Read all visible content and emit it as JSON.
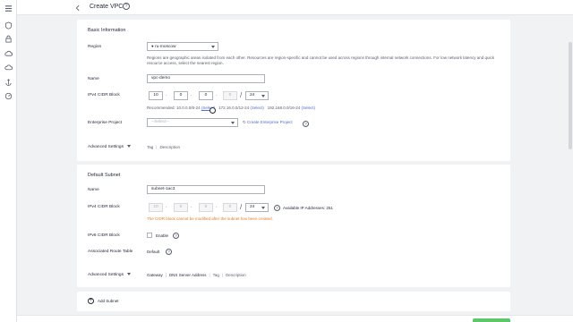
{
  "header": {
    "title": "Create VPC",
    "help_glyph": "?"
  },
  "rail": {
    "items": [
      "menu-icon",
      "shield-icon",
      "lock-icon",
      "cloud-icon",
      "cloud-outline-icon",
      "anchor-icon",
      "gauge-icon"
    ]
  },
  "basic": {
    "section_title": "Basic Information",
    "region": {
      "label": "Region",
      "value": "ru-moscow",
      "hint": "Regions are geographic areas isolated from each other. Resources are region-specific and cannot be used across regions through internal network connections. For low network latency and quick resource access, select the nearest region."
    },
    "name": {
      "label": "Name",
      "value": "vpc-demo"
    },
    "cidr": {
      "label": "IPv4 CIDR Block",
      "octets": [
        "10",
        "0",
        "0",
        "0"
      ],
      "mask": "24",
      "recommended_label": "Recommended:",
      "options": [
        {
          "cidr": "10.0.0.0/8-24",
          "action": "(Select)"
        },
        {
          "cidr": "172.16.0.0/12-24",
          "action": "(Select)"
        },
        {
          "cidr": "192.168.0.0/16-24",
          "action": "(Select)"
        }
      ]
    },
    "enterprise": {
      "label": "Enterprise Project",
      "placeholder": "--Select--",
      "create_link": "Create Enterprise Project"
    },
    "advanced": {
      "label": "Advanced Settings",
      "tabs": [
        "Tag",
        "Description"
      ]
    }
  },
  "subnet": {
    "section_title": "Default Subnet",
    "name": {
      "label": "Name",
      "value": "subnet-1ac3"
    },
    "cidr": {
      "label": "IPv4 CIDR Block",
      "octets": [
        "10",
        "0",
        "0",
        "0"
      ],
      "mask": "24",
      "available": "Available IP Addresses: 251",
      "warning": "The CIDR block cannot be modified after the subnet has been created."
    },
    "ipv6": {
      "label": "IPv6 CIDR Block",
      "checkbox_label": "Enable"
    },
    "route": {
      "label": "Associated Route Table",
      "value": "Default"
    },
    "advanced": {
      "label": "Advanced Settings",
      "tabs": [
        "Gateway",
        "DNS Server Address",
        "Tag",
        "Description"
      ]
    }
  },
  "add_subnet": {
    "label": "Add Subnet"
  },
  "colors": {
    "link": "#526ecc",
    "warning": "#e37d29",
    "confirm": "#5ec66b"
  }
}
